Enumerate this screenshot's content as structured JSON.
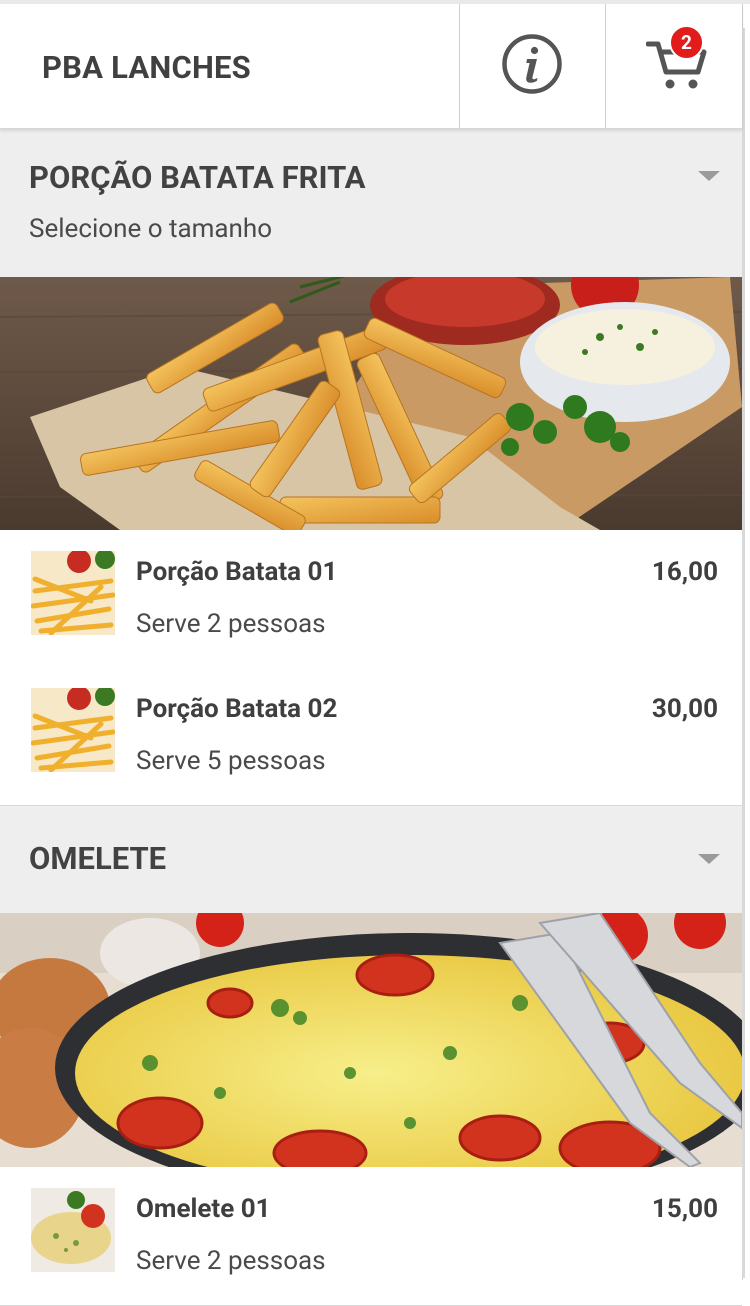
{
  "header": {
    "title": "PBA LANCHES",
    "info_icon": "info-icon",
    "cart_icon": "cart-icon",
    "cart_count": "2"
  },
  "sections": [
    {
      "title": "PORÇÃO BATATA FRITA",
      "subtitle": "Selecione o tamanho",
      "banner": "french-fries-photo",
      "items": [
        {
          "name": "Porção Batata 01",
          "desc": "Serve 2 pessoas",
          "price": "16,00"
        },
        {
          "name": "Porção Batata 02",
          "desc": "Serve 5 pessoas",
          "price": "30,00"
        }
      ]
    },
    {
      "title": "OMELETE",
      "banner": "omelette-photo",
      "items": [
        {
          "name": "Omelete 01",
          "desc": "Serve 2 pessoas",
          "price": "15,00"
        }
      ]
    }
  ],
  "colors": {
    "badge": "#e21b1b",
    "section_bg": "#eeeeee",
    "text": "#3f3f3f"
  }
}
